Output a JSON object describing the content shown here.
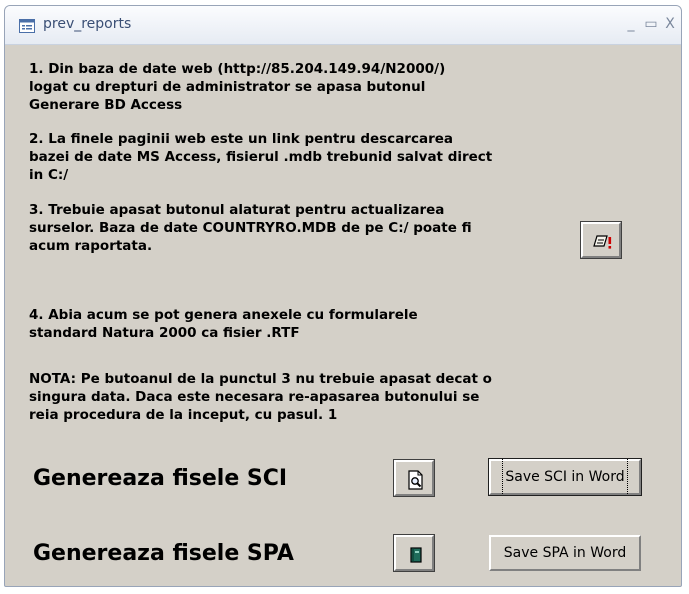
{
  "window": {
    "title": "prev_reports",
    "controls": {
      "minimize": "_",
      "maximize": "▭",
      "close": "X"
    }
  },
  "instructions": {
    "step1": "1. Din baza de date web (http://85.204.149.94/N2000/)\nlogat cu drepturi de administrator se apasa butonul\nGenerare BD Access",
    "step2": "2. La finele paginii web este un link pentru descarcarea\nbazei de date MS Access, fisierul .mdb trebunid salvat direct\nin C:/",
    "step3": "3. Trebuie apasat butonul alaturat pentru actualizarea\nsurselor. Baza de date COUNTRYRO.MDB de pe C:/ poate fi\nacum raportata.",
    "step4": "4. Abia acum se pot genera anexele cu formularele\nstandard Natura 2000 ca fisier .RTF",
    "note": "NOTA: Pe butoanul de la punctul 3 nu trebuie apasat decat o\nsingura data. Daca este necesara re-apasarea butonului se\nreia procedura de la inceput, cu pasul. 1"
  },
  "sci": {
    "label": "Genereaza fisele SCI",
    "save_label": "Save SCI in Word"
  },
  "spa": {
    "label": "Genereaza fisele SPA",
    "save_label": "Save SPA in Word"
  },
  "colors": {
    "window_bg": "#d4d0c8",
    "title_text": "#3a4f75",
    "exclamation": "#cc0000",
    "book_green": "#1e6b5a"
  },
  "icons": {
    "title": "form-icon",
    "update": "update-sources-icon",
    "sci_preview": "print-preview-icon",
    "spa_report": "book-icon"
  }
}
